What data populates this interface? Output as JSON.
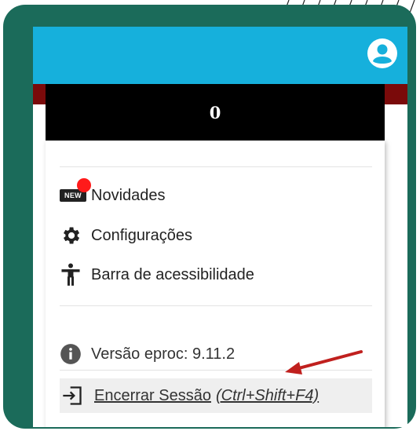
{
  "header": {
    "avatar_icon": "account-circle-icon"
  },
  "counter": {
    "value": "0"
  },
  "menu": {
    "items": [
      {
        "label": "Novidades",
        "icon": "new-badge-icon",
        "badge_text": "NEW"
      },
      {
        "label": "Configurações",
        "icon": "gear-icon"
      },
      {
        "label": "Barra de acessibilidade",
        "icon": "accessibility-icon"
      }
    ],
    "version": {
      "label": "Versão eproc: 9.11.2",
      "icon": "info-icon"
    },
    "logout": {
      "label": "Encerrar Sessão",
      "shortcut": "(Ctrl+Shift+F4)",
      "icon": "logout-icon"
    }
  },
  "colors": {
    "frame": "#1b6b5a",
    "topbar": "#16b0dc",
    "accent_dark_red": "#7a0a0a",
    "annotation_arrow": "#c0201e",
    "notification_dot": "#ff1a1a"
  }
}
